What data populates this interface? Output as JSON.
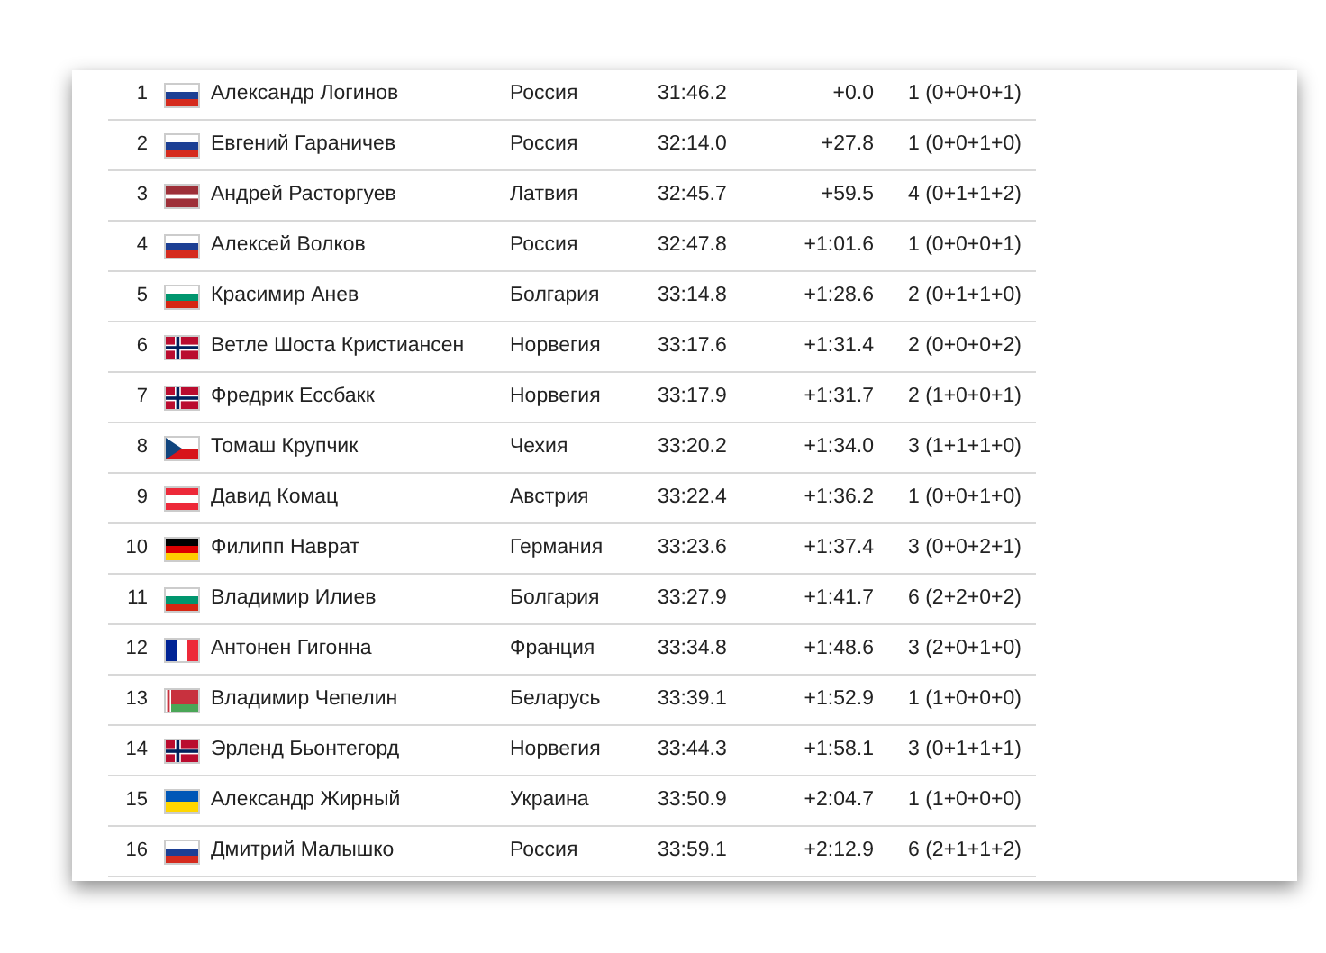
{
  "results": [
    {
      "rank": "1",
      "kind": "ru",
      "name": "Александр Логинов",
      "country": "Россия",
      "time": "31:46.2",
      "behind": "+0.0",
      "penalties": "1 (0+0+0+1)"
    },
    {
      "rank": "2",
      "kind": "ru",
      "name": "Евгений Гараничев",
      "country": "Россия",
      "time": "32:14.0",
      "behind": "+27.8",
      "penalties": "1 (0+0+1+0)"
    },
    {
      "rank": "3",
      "kind": "lv",
      "name": "Андрей Расторгуев",
      "country": "Латвия",
      "time": "32:45.7",
      "behind": "+59.5",
      "penalties": "4 (0+1+1+2)"
    },
    {
      "rank": "4",
      "kind": "ru",
      "name": "Алексей Волков",
      "country": "Россия",
      "time": "32:47.8",
      "behind": "+1:01.6",
      "penalties": "1 (0+0+0+1)"
    },
    {
      "rank": "5",
      "kind": "bg",
      "name": "Красимир Анев",
      "country": "Болгария",
      "time": "33:14.8",
      "behind": "+1:28.6",
      "penalties": "2 (0+1+1+0)"
    },
    {
      "rank": "6",
      "kind": "no",
      "name": "Ветле Шоста Кристиансен",
      "country": "Норвегия",
      "time": "33:17.6",
      "behind": "+1:31.4",
      "penalties": "2 (0+0+0+2)"
    },
    {
      "rank": "7",
      "kind": "no",
      "name": "Фредрик Ессбакк",
      "country": "Норвегия",
      "time": "33:17.9",
      "behind": "+1:31.7",
      "penalties": "2 (1+0+0+1)"
    },
    {
      "rank": "8",
      "kind": "cz",
      "name": "Томаш Крупчик",
      "country": "Чехия",
      "time": "33:20.2",
      "behind": "+1:34.0",
      "penalties": "3 (1+1+1+0)"
    },
    {
      "rank": "9",
      "kind": "at",
      "name": "Давид Комац",
      "country": "Австрия",
      "time": "33:22.4",
      "behind": "+1:36.2",
      "penalties": "1 (0+0+1+0)"
    },
    {
      "rank": "10",
      "kind": "de",
      "name": "Филипп Наврат",
      "country": "Германия",
      "time": "33:23.6",
      "behind": "+1:37.4",
      "penalties": "3 (0+0+2+1)"
    },
    {
      "rank": "11",
      "kind": "bg",
      "name": "Владимир Илиев",
      "country": "Болгария",
      "time": "33:27.9",
      "behind": "+1:41.7",
      "penalties": "6 (2+2+0+2)"
    },
    {
      "rank": "12",
      "kind": "fr",
      "name": "Антонен Гигонна",
      "country": "Франция",
      "time": "33:34.8",
      "behind": "+1:48.6",
      "penalties": "3 (2+0+1+0)"
    },
    {
      "rank": "13",
      "kind": "by",
      "name": "Владимир Чепелин",
      "country": "Беларусь",
      "time": "33:39.1",
      "behind": "+1:52.9",
      "penalties": "1 (1+0+0+0)"
    },
    {
      "rank": "14",
      "kind": "no",
      "name": "Эрленд Бьонтегорд",
      "country": "Норвегия",
      "time": "33:44.3",
      "behind": "+1:58.1",
      "penalties": "3 (0+1+1+1)"
    },
    {
      "rank": "15",
      "kind": "ua",
      "name": "Александр Жирный",
      "country": "Украина",
      "time": "33:50.9",
      "behind": "+2:04.7",
      "penalties": "1 (1+0+0+0)"
    },
    {
      "rank": "16",
      "kind": "ru",
      "name": "Дмитрий Малышко",
      "country": "Россия",
      "time": "33:59.1",
      "behind": "+2:12.9",
      "penalties": "6 (2+1+1+2)"
    }
  ]
}
